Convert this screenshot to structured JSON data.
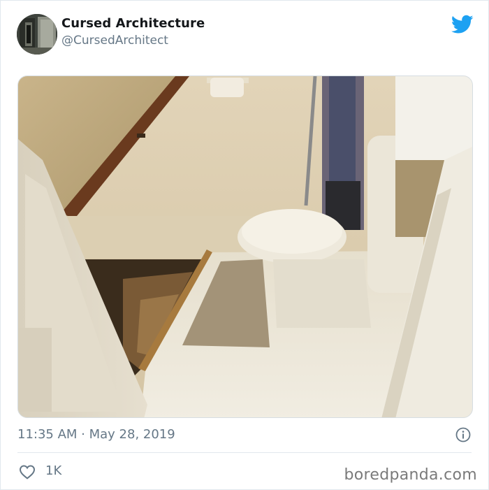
{
  "tweet": {
    "author_name": "Cursed Architecture",
    "author_handle": "@CursedArchitect",
    "timestamp": "11:35 AM · May 28, 2019",
    "likes": "1K"
  },
  "icons": {
    "bird": "twitter-bird-icon",
    "info": "info-icon",
    "heart": "heart-icon"
  },
  "colors": {
    "brand": "#1da1f2",
    "muted_text": "#657786"
  },
  "watermark": "boredpanda.com"
}
